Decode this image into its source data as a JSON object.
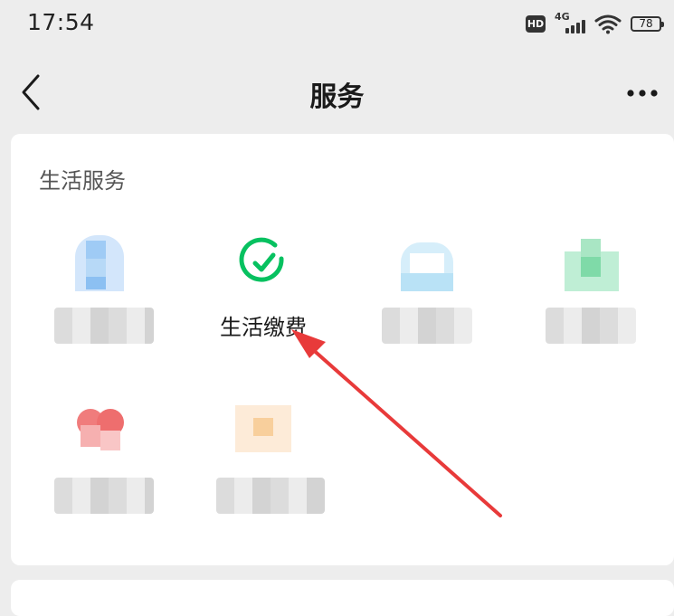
{
  "status_bar": {
    "time": "17:54",
    "network": "4G",
    "hd_label": "HD",
    "battery": "78"
  },
  "nav": {
    "title": "服务",
    "back_icon": "chevron-left-icon",
    "more_icon": "more-dots-icon"
  },
  "section": {
    "title": "生活服务",
    "items": [
      {
        "label": "",
        "icon": "blurred-blue-icon",
        "color": "#7fb8f0"
      },
      {
        "label": "生活缴费",
        "icon": "check-circle-icon",
        "color": "#07c160"
      },
      {
        "label": "",
        "icon": "blurred-cyan-icon",
        "color": "#8fd3f0"
      },
      {
        "label": "",
        "icon": "blurred-green-icon",
        "color": "#6fd6a0"
      },
      {
        "label": "",
        "icon": "blurred-red-icon",
        "color": "#f07070"
      },
      {
        "label": "",
        "icon": "blurred-orange-icon",
        "color": "#f5c890"
      }
    ]
  },
  "annotation": {
    "arrow_color": "#e83a3a"
  }
}
